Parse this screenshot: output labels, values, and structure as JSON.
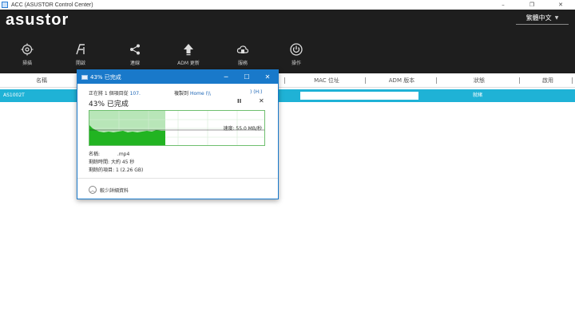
{
  "window": {
    "title": "ACC (ASUSTOR Control Center)",
    "controls": [
      "–",
      "❐",
      "✕"
    ]
  },
  "header": {
    "brand": "asustor",
    "language": "繁體中文",
    "toolbar": [
      {
        "icon": "crosshair-icon",
        "label": "掃描"
      },
      {
        "icon": "ai-open-icon",
        "label": "開啟"
      },
      {
        "icon": "share-icon",
        "label": "連線"
      },
      {
        "icon": "upload-arrow-icon",
        "label": "ADM 更新"
      },
      {
        "icon": "cloud-service-icon",
        "label": "服務"
      },
      {
        "icon": "power-icon",
        "label": "操作"
      }
    ]
  },
  "table": {
    "columns": [
      "名稱",
      "MAC 位址",
      "ADM 版本",
      "狀態",
      "啟用"
    ],
    "rows": [
      {
        "name": "AS1002T",
        "mac": "",
        "adm": "",
        "status": "就緒",
        "enabled": ""
      }
    ]
  },
  "dialog": {
    "title": "43% 已完成",
    "controls": [
      "─",
      "☐",
      "✕"
    ],
    "copy_prefix": "正在將 1 個項目從",
    "copy_source": "107.",
    "copy_to_label": "複製到",
    "copy_dest": "Home (\\\\",
    "copy_drive": ") (H:)",
    "percent_text": "43% 已完成",
    "pause_symbol": "II",
    "cancel_symbol": "✕",
    "progress": 0.43,
    "speed_text": "速度: 55.0 MB/秒",
    "info": [
      {
        "key": "名稱:",
        "value": ".mp4"
      },
      {
        "key": "剩餘時間:",
        "value": "大約 45 秒"
      },
      {
        "key": "剩餘的項目:",
        "value": "1 (2.26 GB)"
      }
    ],
    "less_details": "較少詳細資料"
  },
  "colors": {
    "header_bg": "#1e1e1e",
    "row_selected": "#1fb2d6",
    "dialog_accent": "#1979ca",
    "graph_fill": "#22b422"
  }
}
